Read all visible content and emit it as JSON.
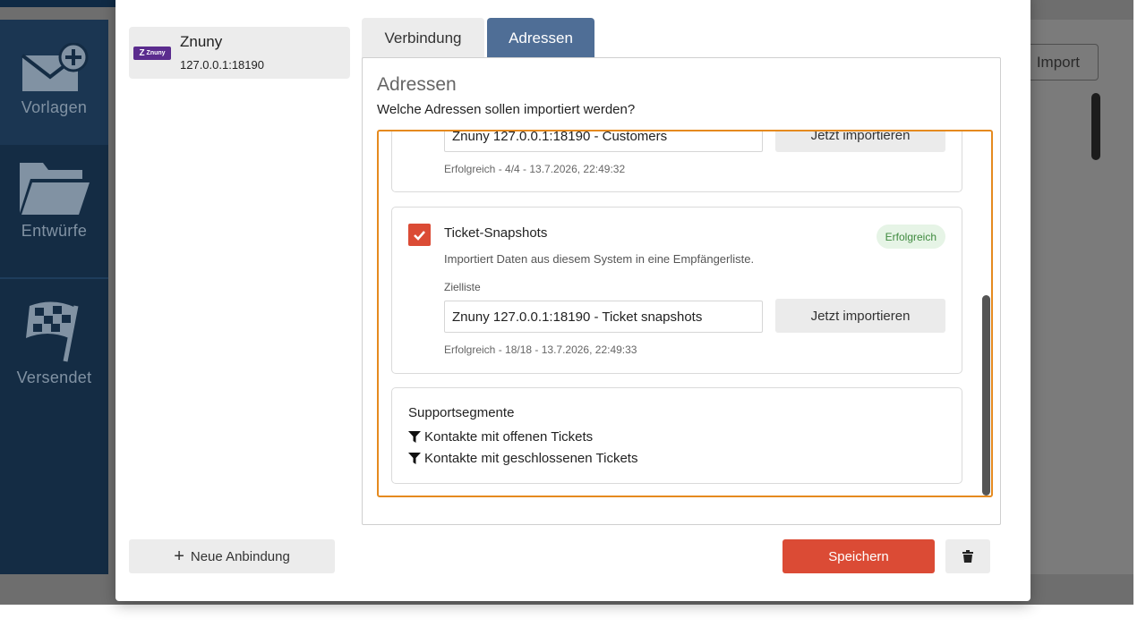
{
  "sidebar": {
    "items": [
      {
        "label": "Vorlagen",
        "icon": "mail-plus-icon"
      },
      {
        "label": "Entwürfe",
        "icon": "folder-icon"
      },
      {
        "label": "Versendet",
        "icon": "checkered-flag-icon"
      }
    ]
  },
  "background": {
    "import_label": "Import"
  },
  "connection": {
    "logo_text": "Znuny",
    "name": "Znuny",
    "host": "127.0.0.1:18190"
  },
  "tabs": [
    {
      "label": "Verbindung",
      "active": false
    },
    {
      "label": "Adressen",
      "active": true
    }
  ],
  "panel": {
    "title": "Adressen",
    "question": "Welche Adressen sollen importiert werden?"
  },
  "customers": {
    "target_list": "Znuny 127.0.0.1:18190 - Customers",
    "import_button": "Jetzt importieren",
    "status": "Erfolgreich - 4/4 - 13.7.2026, 22:49:32"
  },
  "snapshots": {
    "checked": true,
    "title": "Ticket-Snapshots",
    "badge": "Erfolgreich",
    "description": "Importiert Daten aus diesem System in eine Empfängerliste.",
    "field_label": "Zielliste",
    "target_list": "Znuny 127.0.0.1:18190 - Ticket snapshots",
    "import_button": "Jetzt importieren",
    "status": "Erfolgreich - 18/18 - 13.7.2026, 22:49:33"
  },
  "segments": {
    "title": "Supportsegmente",
    "items": [
      {
        "label": "Kontakte mit offenen Tickets",
        "icon": "filter-icon"
      },
      {
        "label": "Kontakte mit geschlossenen Tickets",
        "icon": "filter-icon"
      }
    ]
  },
  "footer": {
    "new_connection": "Neue Anbindung",
    "save": "Speichern"
  },
  "colors": {
    "accent_red": "#db4b35",
    "tab_active": "#4f6e96",
    "focus_border": "#e58a1f",
    "sidebar_bg": "#142c44",
    "success_bg": "#e6f4e6",
    "success_text": "#3f8a3f"
  }
}
